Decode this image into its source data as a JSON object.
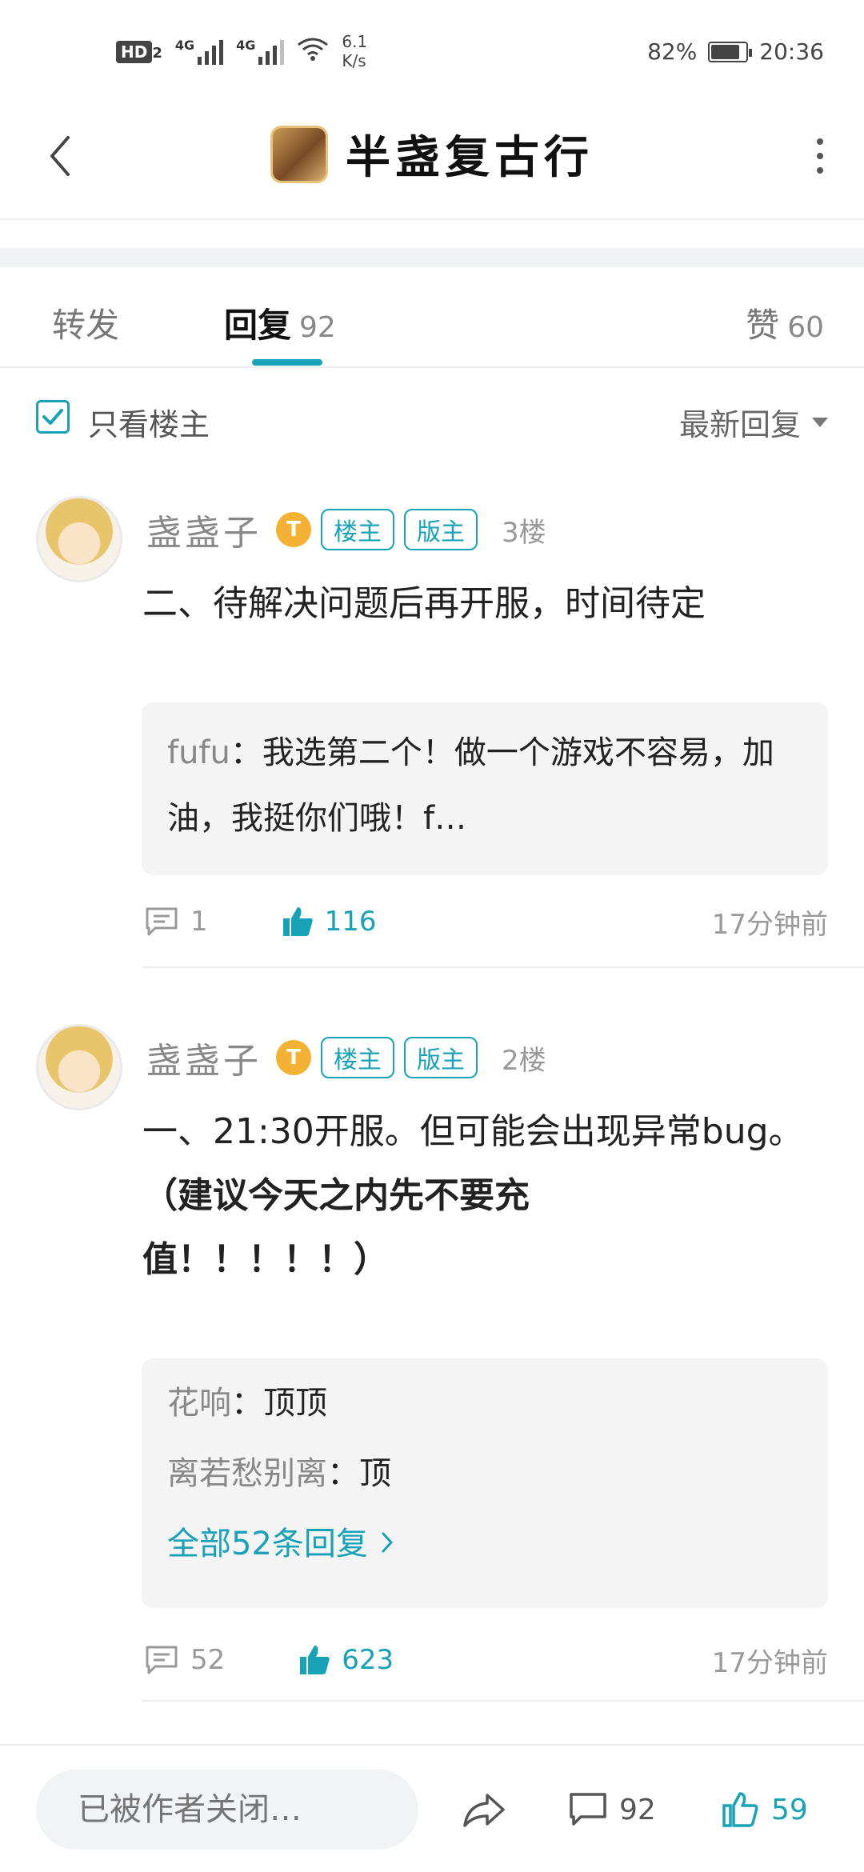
{
  "status_bar": {
    "hd_label": "HD",
    "hd_sub": "2",
    "signal_1_label": "4G",
    "signal_2_label": "4G",
    "speed_value": "6.1",
    "speed_unit": "K/s",
    "battery": "82%",
    "battery_level": 0.82,
    "time": "20:36"
  },
  "header": {
    "title": "半盏复古行"
  },
  "tabs": {
    "forward_label": "转发",
    "reply_label": "回复",
    "reply_count": "92",
    "like_label": "赞",
    "like_count": "60"
  },
  "filter": {
    "only_op_label": "只看楼主",
    "only_op_checked": true,
    "sort_label": "最新回复"
  },
  "posts": [
    {
      "username": "盏盏子",
      "level_badge": "T",
      "tags": [
        "楼主",
        "版主"
      ],
      "floor": "3楼",
      "body_lines": [
        "二、待解决问题后再开服，时间待定"
      ],
      "quote": {
        "name": "fufu",
        "text": "：我选第二个！做一个游戏不容易，加油，我挺你们哦！f…"
      },
      "comments": "1",
      "likes": "116",
      "time": "17分钟前"
    },
    {
      "username": "盏盏子",
      "level_badge": "T",
      "tags": [
        "楼主",
        "版主"
      ],
      "floor": "2楼",
      "body_line_1": "一、21:30开服。但可能会出现异常bug。",
      "body_line_2": "（建议今天之内先不要充值！！！！！）",
      "replies": [
        {
          "name": "花响",
          "text": "：顶顶"
        },
        {
          "name": "离若愁别离",
          "text": "：顶"
        }
      ],
      "all_replies_link": "全部52条回复",
      "comments": "52",
      "likes": "623",
      "time": "17分钟前"
    }
  ],
  "bottom_bar": {
    "reply_placeholder": "已被作者关闭…",
    "comment_count": "92",
    "like_count": "59"
  },
  "colors": {
    "accent": "#17a2b8",
    "badge": "#f3b233"
  },
  "icons": [
    "back-icon",
    "more-icon",
    "check-icon",
    "caret-down-icon",
    "comment-icon",
    "thumbs-up-icon",
    "share-icon"
  ]
}
